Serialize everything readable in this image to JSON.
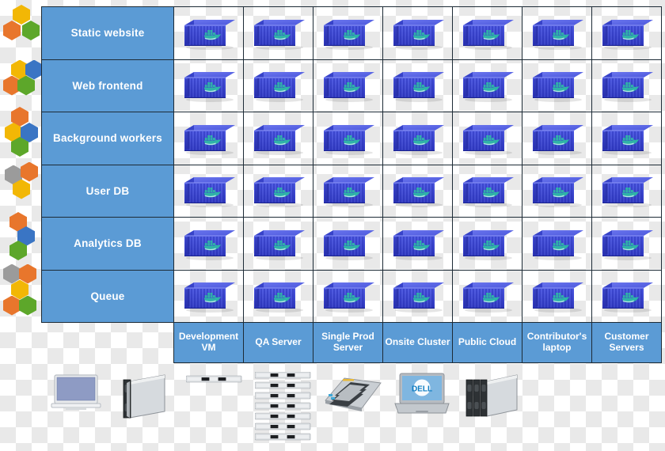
{
  "diagram": {
    "title_present": false,
    "accent_blue": "#5b9bd5",
    "border_color": "#1d2b36",
    "container_color": "#3a48d6",
    "whale_color": "#2fb3a8"
  },
  "rows": [
    {
      "label": "Static website",
      "icon": "hex-cluster-3-icon",
      "hexes": [
        {
          "color": "#f2b705",
          "x": 16,
          "y": 2
        },
        {
          "color": "#e8762c",
          "x": 4,
          "y": 22
        },
        {
          "color": "#5da72a",
          "x": 28,
          "y": 22
        }
      ]
    },
    {
      "label": "Web frontend",
      "icon": "hex-cluster-4-icon",
      "hexes": [
        {
          "color": "#f2b705",
          "x": 14,
          "y": 6
        },
        {
          "color": "#3a75c4",
          "x": 32,
          "y": 6
        },
        {
          "color": "#e8762c",
          "x": 4,
          "y": 26
        },
        {
          "color": "#5da72a",
          "x": 22,
          "y": 26
        }
      ]
    },
    {
      "label": "Background workers",
      "icon": "hex-cluster-4-stagger-icon",
      "hexes": [
        {
          "color": "#e8762c",
          "x": 14,
          "y": 0
        },
        {
          "color": "#f2b705",
          "x": 6,
          "y": 20
        },
        {
          "color": "#3a75c4",
          "x": 26,
          "y": 20
        },
        {
          "color": "#5da72a",
          "x": 14,
          "y": 38
        }
      ]
    },
    {
      "label": "User DB",
      "icon": "hex-cluster-3-gray-icon",
      "hexes": [
        {
          "color": "#9b9b9b",
          "x": 6,
          "y": 8
        },
        {
          "color": "#e8762c",
          "x": 26,
          "y": 4
        },
        {
          "color": "#f2b705",
          "x": 16,
          "y": 26
        }
      ]
    },
    {
      "label": "Analytics  DB",
      "icon": "hex-cluster-3-diag-icon",
      "hexes": [
        {
          "color": "#e8762c",
          "x": 12,
          "y": 2
        },
        {
          "color": "#3a75c4",
          "x": 22,
          "y": 20
        },
        {
          "color": "#5da72a",
          "x": 12,
          "y": 38
        }
      ]
    },
    {
      "label": "Queue",
      "icon": "hex-cluster-5-icon",
      "hexes": [
        {
          "color": "#9b9b9b",
          "x": 4,
          "y": 2
        },
        {
          "color": "#e8762c",
          "x": 24,
          "y": 2
        },
        {
          "color": "#f2b705",
          "x": 14,
          "y": 22
        },
        {
          "color": "#e8762c",
          "x": 4,
          "y": 42
        },
        {
          "color": "#5da72a",
          "x": 24,
          "y": 42
        }
      ]
    }
  ],
  "columns": [
    {
      "label": "Development VM",
      "hardware": "laptop-monitor-icon"
    },
    {
      "label": "QA  Server",
      "hardware": "blade-server-icon"
    },
    {
      "label": "Single Prod Server",
      "hardware": "rack-server-icon"
    },
    {
      "label": "Onsite Cluster",
      "hardware": "rack-server-stack-icon"
    },
    {
      "label": "Public Cloud",
      "hardware": "server-board-icon"
    },
    {
      "label": "Contributor's laptop",
      "hardware": "dell-laptop-icon",
      "brand": "DELL"
    },
    {
      "label": "Customer Servers",
      "hardware": "blade-server-group-icon"
    }
  ],
  "cell_icon": "docker-container-icon",
  "grid": {
    "rows": 6,
    "cols": 7,
    "total_cells": 42
  }
}
